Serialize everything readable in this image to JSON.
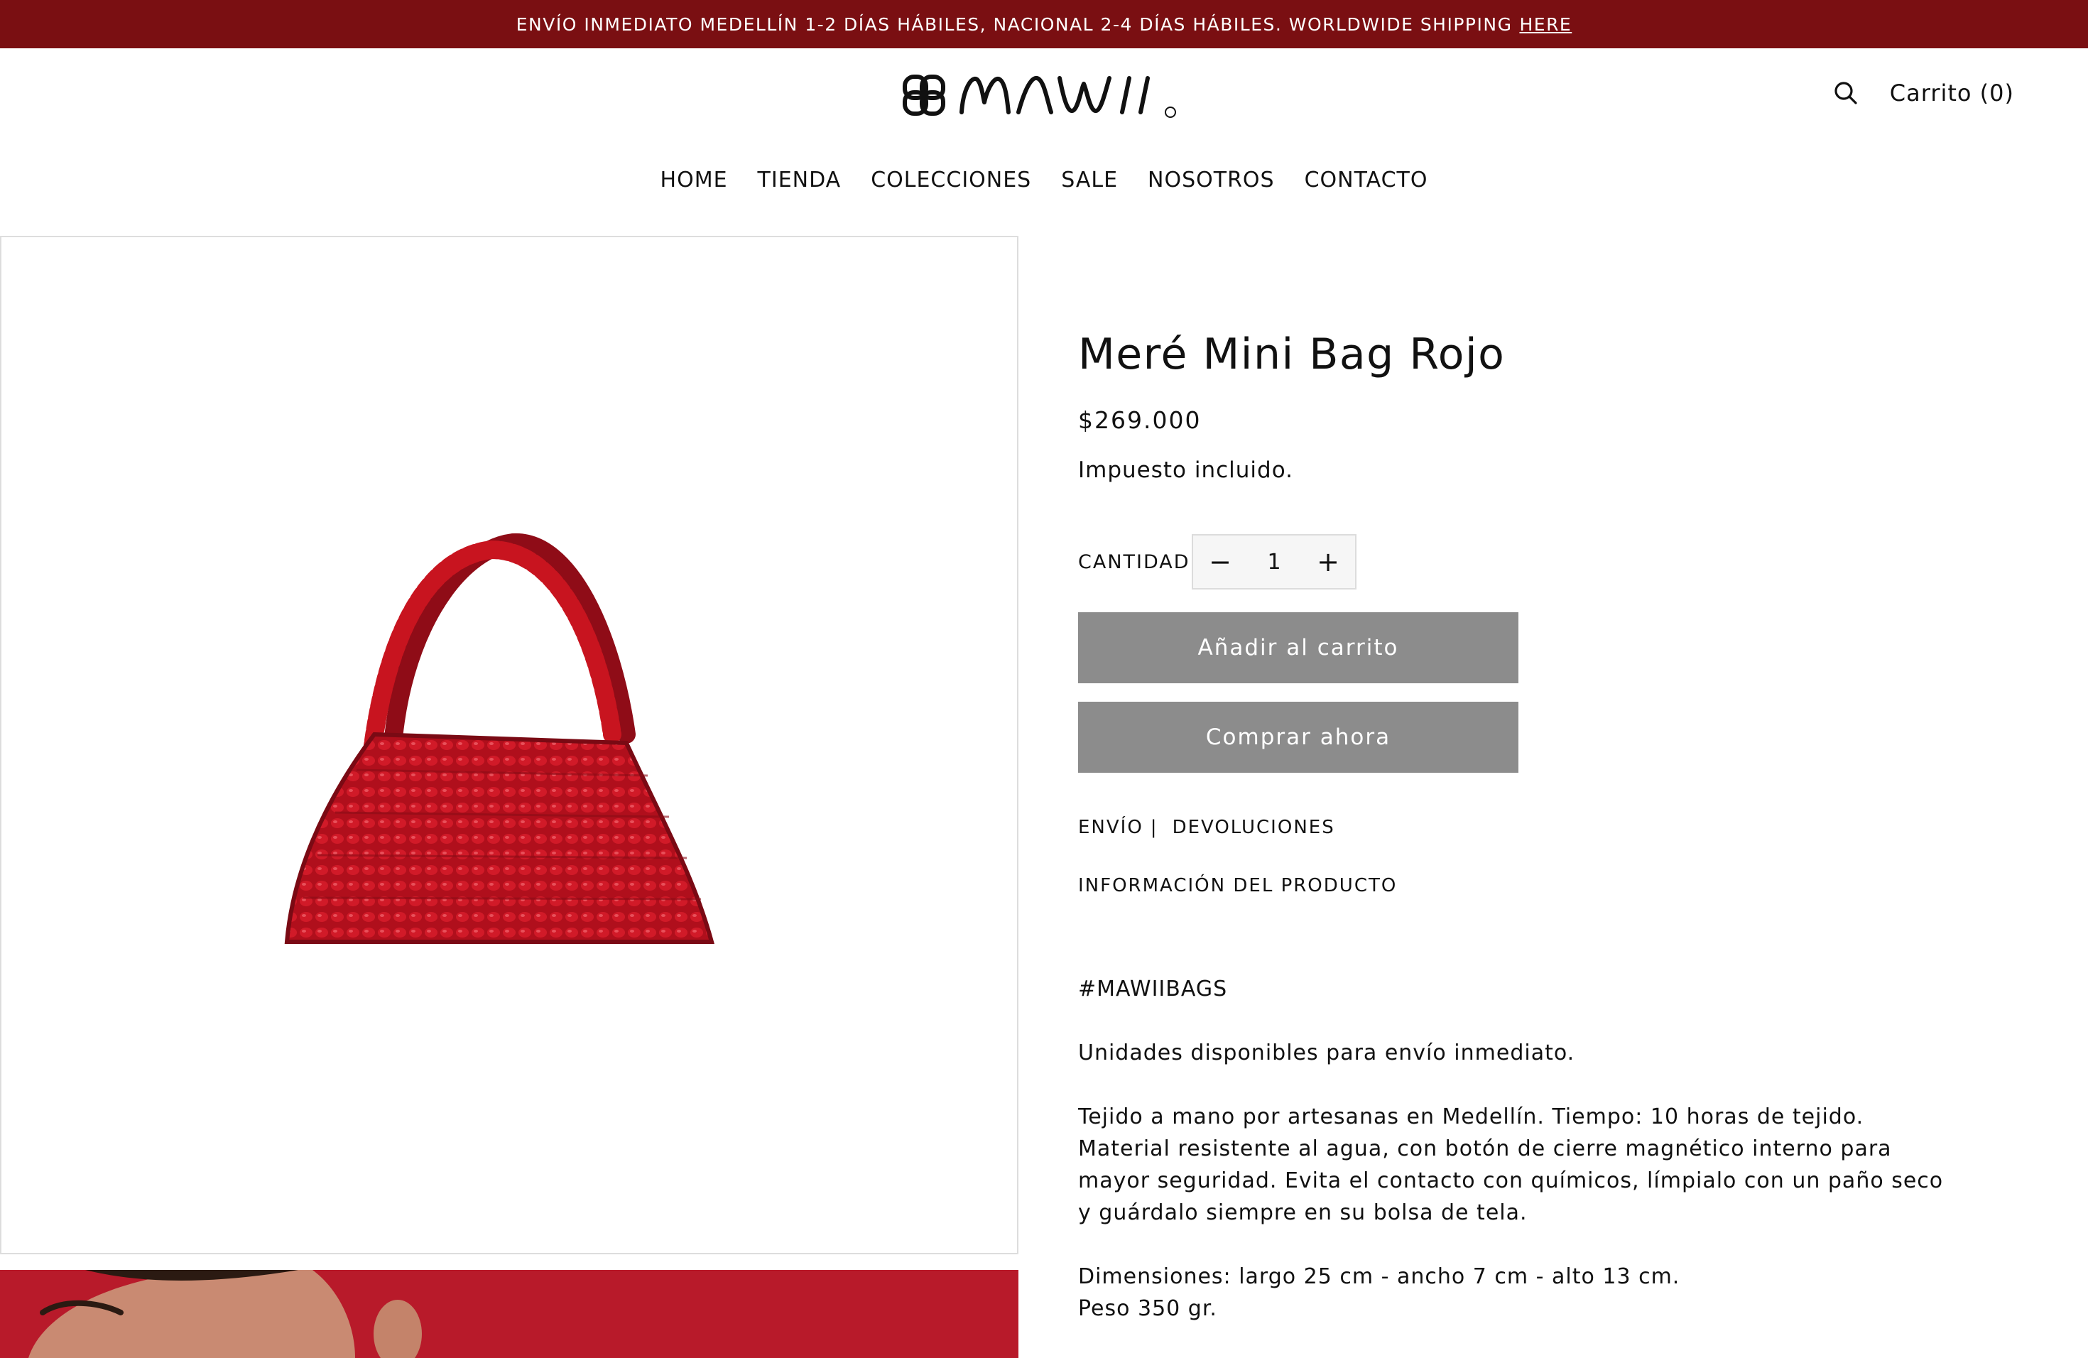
{
  "announcement": {
    "text": "ENVÍO INMEDIATO MEDELLÍN 1-2 DÍAS HÁBILES, NACIONAL 2-4 DÍAS HÁBILES. WORLDWIDE SHIPPING",
    "link_label": "HERE",
    "background": "#7a0f12"
  },
  "header": {
    "logo_icon": "mawii-knot-logo",
    "logo_text": "MAWII",
    "search_icon": "search-icon",
    "cart_label": "Carrito (0)"
  },
  "nav": {
    "items": [
      "HOME",
      "TIENDA",
      "COLECCIONES",
      "SALE",
      "NOSOTROS",
      "CONTACTO"
    ]
  },
  "product": {
    "title": "Meré Mini Bag Rojo",
    "price": "$269.000",
    "tax_note": "Impuesto incluido.",
    "quantity_label": "CANTIDAD",
    "quantity_value": "1",
    "decrement_symbol": "−",
    "increment_symbol": "+",
    "add_to_cart_label": "Añadir al carrito",
    "buy_now_label": "Comprar ahora",
    "button_color": "#8c8c8c",
    "shipping_link": "ENVÍO",
    "policy_separator": "|",
    "returns_link": "DEVOLUCIONES",
    "info_link": "INFORMACIÓN DEL PRODUCTO",
    "bag_color": "#c0121f"
  },
  "description": {
    "hashtag": "#MAWIIBAGS",
    "availability": "Unidades disponibles para envío inmediato.",
    "care_lines": [
      "Tejido a mano por artesanas en Medellín. Tiempo: 10 horas de tejido.",
      "Material resistente al agua, con botón de cierre magnético interno para",
      "mayor seguridad. Evita el contacto con químicos, límpialo con un paño seco",
      "y guárdalo siempre en su bolsa de tela."
    ],
    "dimension_lines": [
      "Dimensiones: largo 25 cm - ancho 7 cm - alto 13 cm.",
      "Peso 350 gr."
    ]
  }
}
